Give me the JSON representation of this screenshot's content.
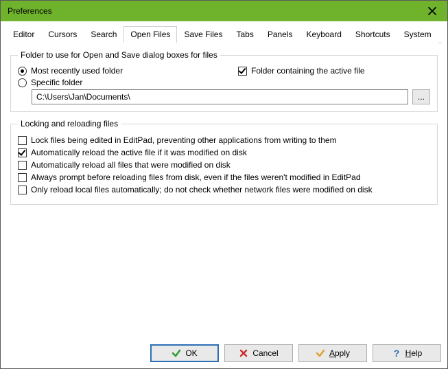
{
  "window": {
    "title": "Preferences"
  },
  "tabs": [
    "Editor",
    "Cursors",
    "Search",
    "Open Files",
    "Save Files",
    "Tabs",
    "Panels",
    "Keyboard",
    "Shortcuts",
    "System"
  ],
  "activeTab": 3,
  "folderGroup": {
    "legend": "Folder to use for Open and Save dialog boxes for files",
    "mruLabel": "Most recently used folder",
    "activeFileLabel": "Folder containing the active file",
    "specificLabel": "Specific folder",
    "pathValue": "C:\\Users\\Jan\\Documents\\",
    "browseLabel": "..."
  },
  "lockGroup": {
    "legend": "Locking and reloading files",
    "opt1": "Lock files being edited in EditPad, preventing other applications from writing to them",
    "opt2": "Automatically reload the active file if it was modified on disk",
    "opt3": "Automatically reload all files that were modified on disk",
    "opt4": "Always prompt before reloading files from disk, even if the files weren't modified in EditPad",
    "opt5": "Only reload local files automatically; do not check whether network files were modified on disk"
  },
  "buttons": {
    "ok": "OK",
    "cancel": "Cancel",
    "apply": "Apply",
    "help": "Help"
  }
}
